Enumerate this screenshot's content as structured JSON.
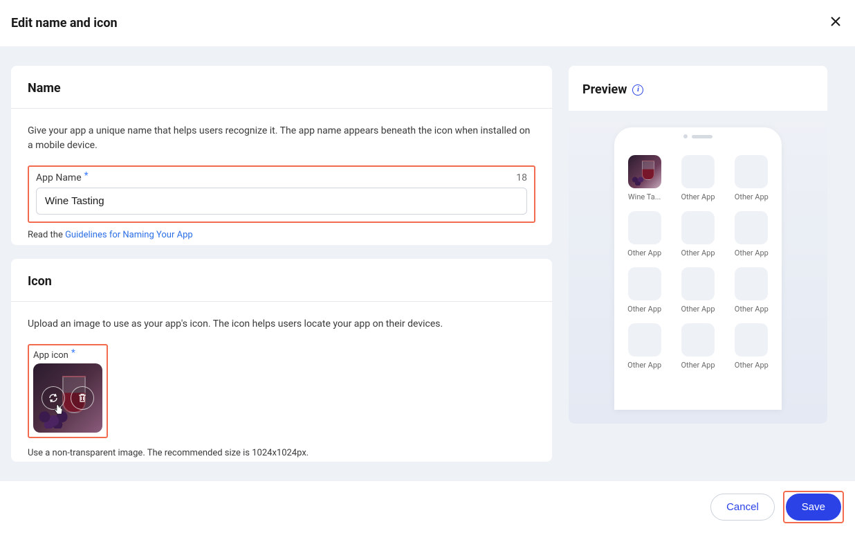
{
  "modal_title": "Edit name and icon",
  "name_section": {
    "title": "Name",
    "description": "Give your app a unique name that helps users recognize it. The app name appears beneath the icon when installed on a mobile device.",
    "field_label": "App Name",
    "char_limit": "18",
    "value": "Wine Tasting",
    "helper_prefix": "Read the ",
    "helper_link": "Guidelines for Naming Your App"
  },
  "icon_section": {
    "title": "Icon",
    "description": "Upload an image to use as your app's icon. The icon helps users locate your app on their devices.",
    "field_label": "App icon",
    "helper_text": "Use a non-transparent image. The recommended size is 1024x1024px."
  },
  "preview": {
    "title": "Preview",
    "featured_label": "Wine Ta...",
    "other_label": "Other App"
  },
  "footer": {
    "cancel": "Cancel",
    "save": "Save"
  }
}
